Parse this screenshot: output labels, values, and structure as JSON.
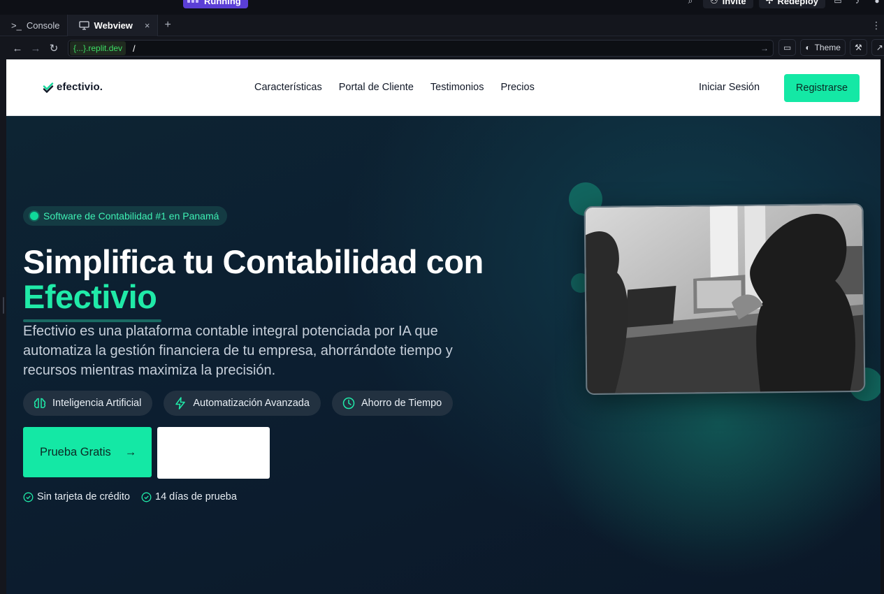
{
  "ide": {
    "run_badge": "Running",
    "invite_label": "Invite",
    "redeploy_label": "Redeploy",
    "tabs": [
      {
        "label": "Console",
        "icon": "terminal-icon"
      },
      {
        "label": "Webview",
        "icon": "monitor-icon",
        "close": "×"
      }
    ],
    "add_tab": "+",
    "url_host": "{...}.replit.dev",
    "url_path": "/",
    "theme_label": "Theme"
  },
  "site": {
    "brand": "efectivio.",
    "nav": [
      "Características",
      "Portal de Cliente",
      "Testimonios",
      "Precios"
    ],
    "login": "Iniciar Sesión",
    "signup": "Registrarse",
    "hero": {
      "badge": "Software de Contabilidad #1 en Panamá",
      "headline": "Simplifica tu Contabilidad con",
      "headline_accent": "Efectivio",
      "subtitle": "Efectivio es una plataforma contable integral potenciada por IA que automatiza la gestión financiera de tu empresa, ahorrándote tiempo y recursos mientras maximiza la precisión.",
      "chips": [
        {
          "label": "Inteligencia Artificial",
          "icon": "brain-icon"
        },
        {
          "label": "Automatización Avanzada",
          "icon": "lightning-icon"
        },
        {
          "label": "Ahorro de Tiempo",
          "icon": "clock-icon"
        }
      ],
      "cta_primary": "Prueba Gratis",
      "cta_arrow": "→",
      "checks": [
        "Sin tarjeta de crédito",
        "14 días de prueba"
      ]
    }
  },
  "colors": {
    "accent": "#14e8a5",
    "accent_text": "#20eaa8",
    "hero_bg": "#0c1e30",
    "ide_bg": "#14161d",
    "run_badge": "#5b3fd6",
    "url_host": "#3ddc64"
  }
}
